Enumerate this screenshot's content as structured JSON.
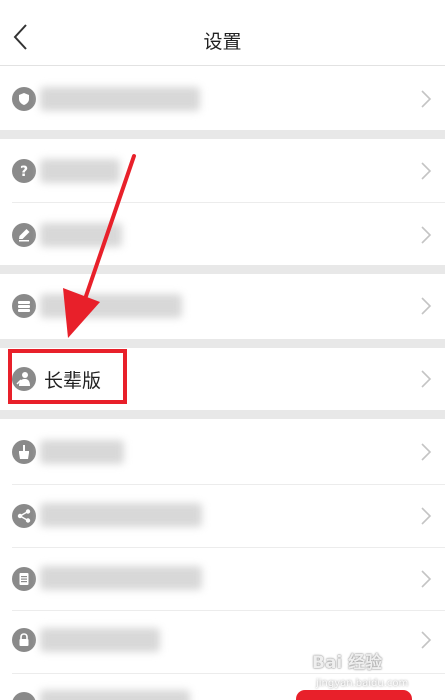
{
  "header": {
    "title": "设置"
  },
  "icons": {
    "back": "chevron-left-icon",
    "row_icons": [
      "shield-icon",
      "question-icon",
      "pencil-icon",
      "archive-icon",
      "elder-icon",
      "broom-icon",
      "share-icon",
      "document-icon",
      "lock-icon"
    ],
    "row_chevron": "chevron-right-icon"
  },
  "rows": [
    {
      "label": ""
    },
    {
      "label": ""
    },
    {
      "label": ""
    },
    {
      "label": ""
    },
    {
      "label": "长辈版"
    },
    {
      "label": ""
    },
    {
      "label": ""
    },
    {
      "label": ""
    },
    {
      "label": ""
    }
  ],
  "watermark": {
    "brand": "Bai 经验",
    "url": "jingyan.baidu.com"
  },
  "colors": {
    "accent": "#e8202a",
    "icon_gray": "#8a8a8a",
    "divider_band": "#e8e8e8"
  }
}
